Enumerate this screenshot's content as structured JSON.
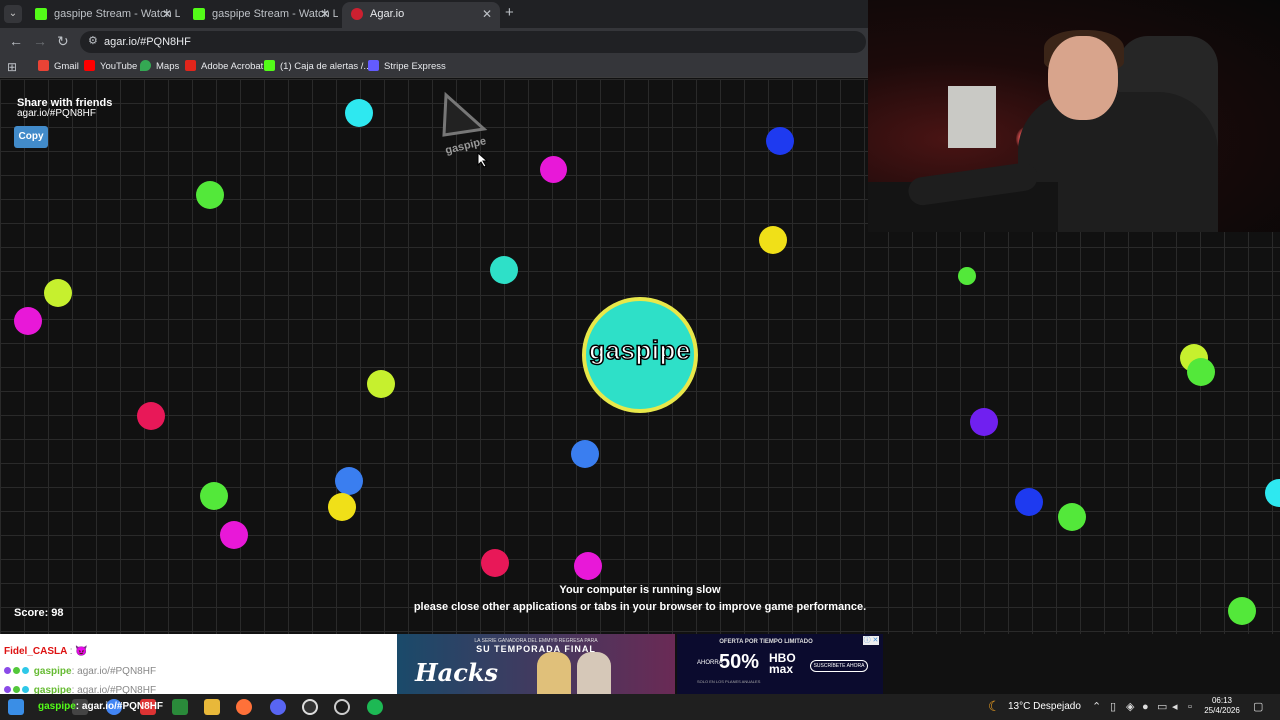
{
  "browser": {
    "tabs": [
      {
        "title": "gaspipe Stream - Watch Live on Kick",
        "icon_color": "#53fc18",
        "active": false
      },
      {
        "title": "gaspipe Stream - Watch Live on Kick",
        "icon_color": "#53fc18",
        "active": false
      },
      {
        "title": "Agar.io",
        "icon_color": "#cc2030",
        "active": true
      }
    ],
    "close_glyph": "✕",
    "new_tab_glyph": "+",
    "url": "agar.io/#PQN8HF",
    "bookmarks": [
      {
        "label": "Gmail",
        "icon": "gmail-icon",
        "color": "#ea4335"
      },
      {
        "label": "YouTube",
        "icon": "youtube-icon",
        "color": "#ff0000"
      },
      {
        "label": "Maps",
        "icon": "maps-icon",
        "color": "#34a853"
      },
      {
        "label": "Adobe Acrobat",
        "icon": "acrobat-icon",
        "color": "#e1251b"
      },
      {
        "label": "(1) Caja de alertas /...",
        "icon": "alerts-icon",
        "color": "#53fc18"
      },
      {
        "label": "Stripe Express",
        "icon": "stripe-icon",
        "color": "#635bff"
      }
    ]
  },
  "game": {
    "share_title": "Share with friends",
    "share_link": "agar.io/#PQN8HF",
    "copy_label": "Copy",
    "player_name": "gaspipe",
    "marker_name": "gaspipe",
    "score": "Score: 98",
    "warning_line1": "Your computer is running slow",
    "warning_line2": "please close other applications or tabs in your browser to improve game performance.",
    "player_cell_color": "#2ee0c8",
    "player_cell_border": "#e8e84a",
    "pellet_colors": [
      "#2ee8f0",
      "#53e83a",
      "#e818d8",
      "#1e3af0",
      "#f0e018",
      "#2ee0c8",
      "#c6f02e",
      "#e81858",
      "#3a7ef0",
      "#7020f0"
    ]
  },
  "chat": {
    "line1_user": "Fidel_CASLA",
    "line1_sep": ":",
    "line1_emote": "😈",
    "line2_user": "gaspipe",
    "line2_msg": ": agar.io/#PQN8HF",
    "line3_user": "gaspipe",
    "line3_msg": ": agar.io/#PQN8HF"
  },
  "ads": {
    "ad1_top": "LA SERIE GANADORA DEL EMMY® REGRESA PARA",
    "ad1_title": "SU TEMPORADA FINAL",
    "ad1_show": "Hacks",
    "ad2_top": "OFERTA POR TIEMPO LIMITADO",
    "ad2_ahorra": "AHORRA",
    "ad2_pct": "50%",
    "ad2_note": "SOLO EN LOS PLANES ANUALES",
    "ad2_brand1": "HBO",
    "ad2_brand2": "max",
    "ad2_cta": "SUSCRÍBETE AHORA",
    "ad2_close": "ⓘ ✕"
  },
  "taskbar": {
    "overlay_user": "gaspipe",
    "overlay_msg": ": agar.io/#PQN8HF",
    "weather": "13°C  Despejado",
    "time": "06:13",
    "date": "25/4/2026"
  }
}
